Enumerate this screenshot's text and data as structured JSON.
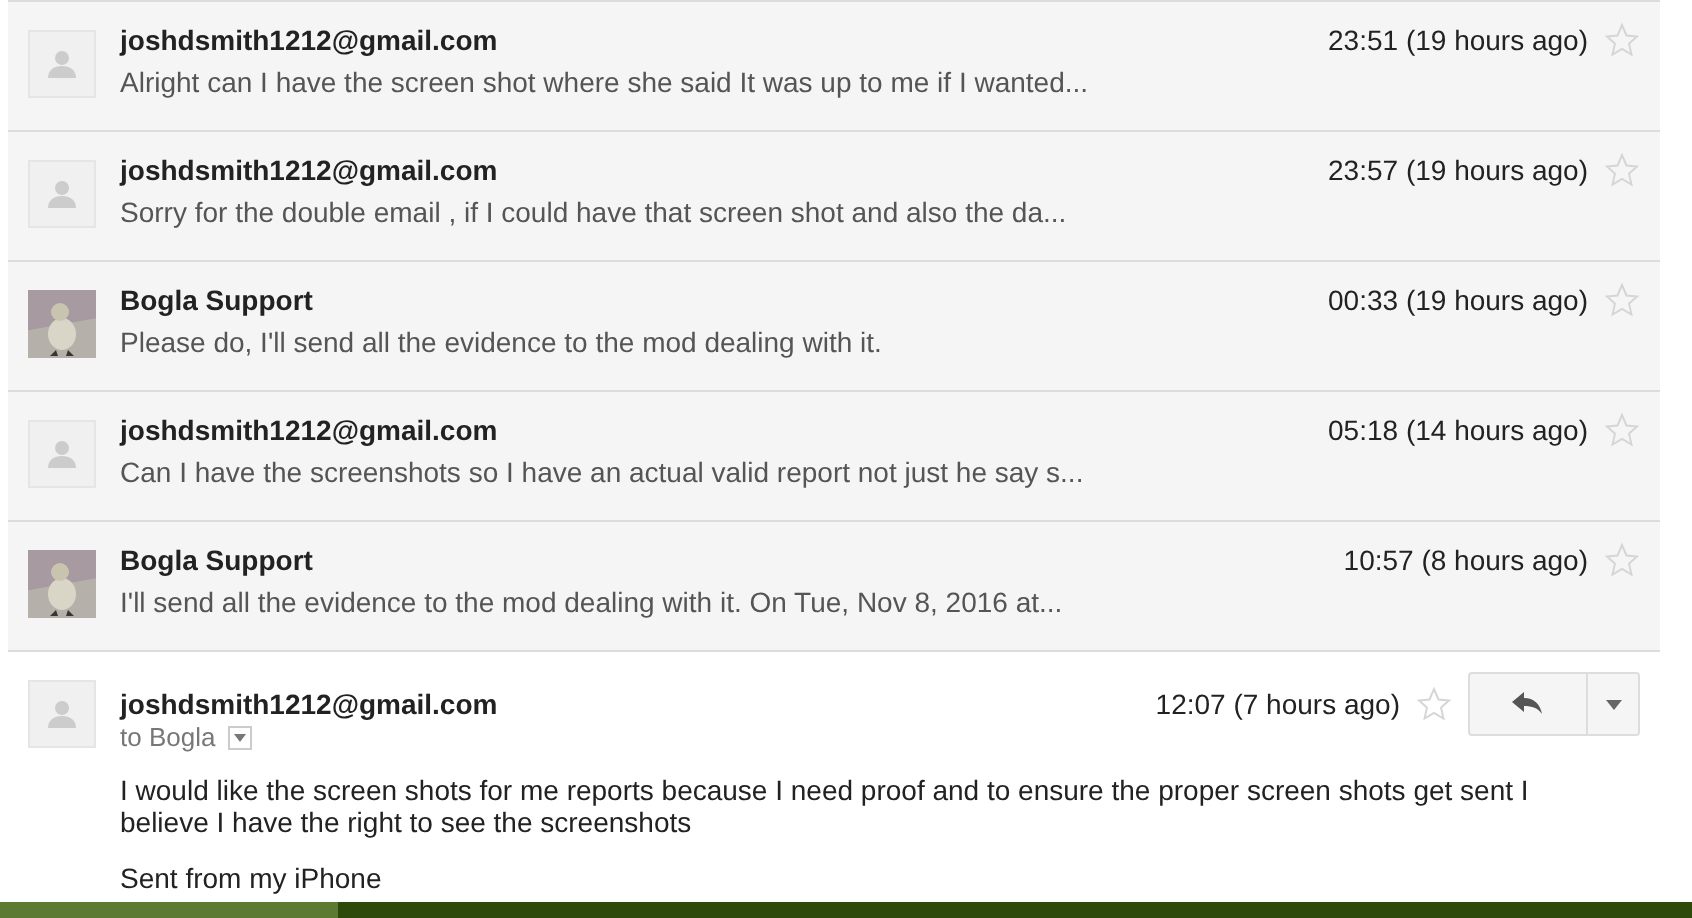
{
  "messages": [
    {
      "kind": "collapsed",
      "photo": false,
      "sender": "joshdsmith1212@gmail.com",
      "time": "23:51 (19 hours ago)",
      "starred": false,
      "snippet": "Alright can I have the screen shot where she said It was up to me if I wanted..."
    },
    {
      "kind": "collapsed",
      "photo": false,
      "sender": "joshdsmith1212@gmail.com",
      "time": "23:57 (19 hours ago)",
      "starred": false,
      "snippet": "Sorry for the double email , if I could have that screen shot and also the da..."
    },
    {
      "kind": "collapsed",
      "photo": true,
      "sender": "Bogla Support",
      "time": "00:33 (19 hours ago)",
      "starred": false,
      "snippet": "Please do, I'll send all the evidence to the mod dealing with it."
    },
    {
      "kind": "collapsed",
      "photo": false,
      "sender": "joshdsmith1212@gmail.com",
      "time": "05:18 (14 hours ago)",
      "starred": false,
      "snippet": "Can I have the screenshots so I have an actual valid report not just he say s..."
    },
    {
      "kind": "collapsed",
      "photo": true,
      "sender": "Bogla Support",
      "time": "10:57 (8 hours ago)",
      "starred": false,
      "snippet": "I'll send all the evidence to the mod dealing with it. On Tue, Nov 8, 2016 at..."
    },
    {
      "kind": "expanded",
      "photo": false,
      "sender": "joshdsmith1212@gmail.com",
      "time": "12:07 (7 hours ago)",
      "starred": false,
      "recipient": "to Bogla",
      "body": [
        "I would like the screen shots for me reports because I need proof and to ensure the proper screen shots get sent I believe I have the right to see the screenshots",
        "Sent from my iPhone"
      ]
    }
  ]
}
